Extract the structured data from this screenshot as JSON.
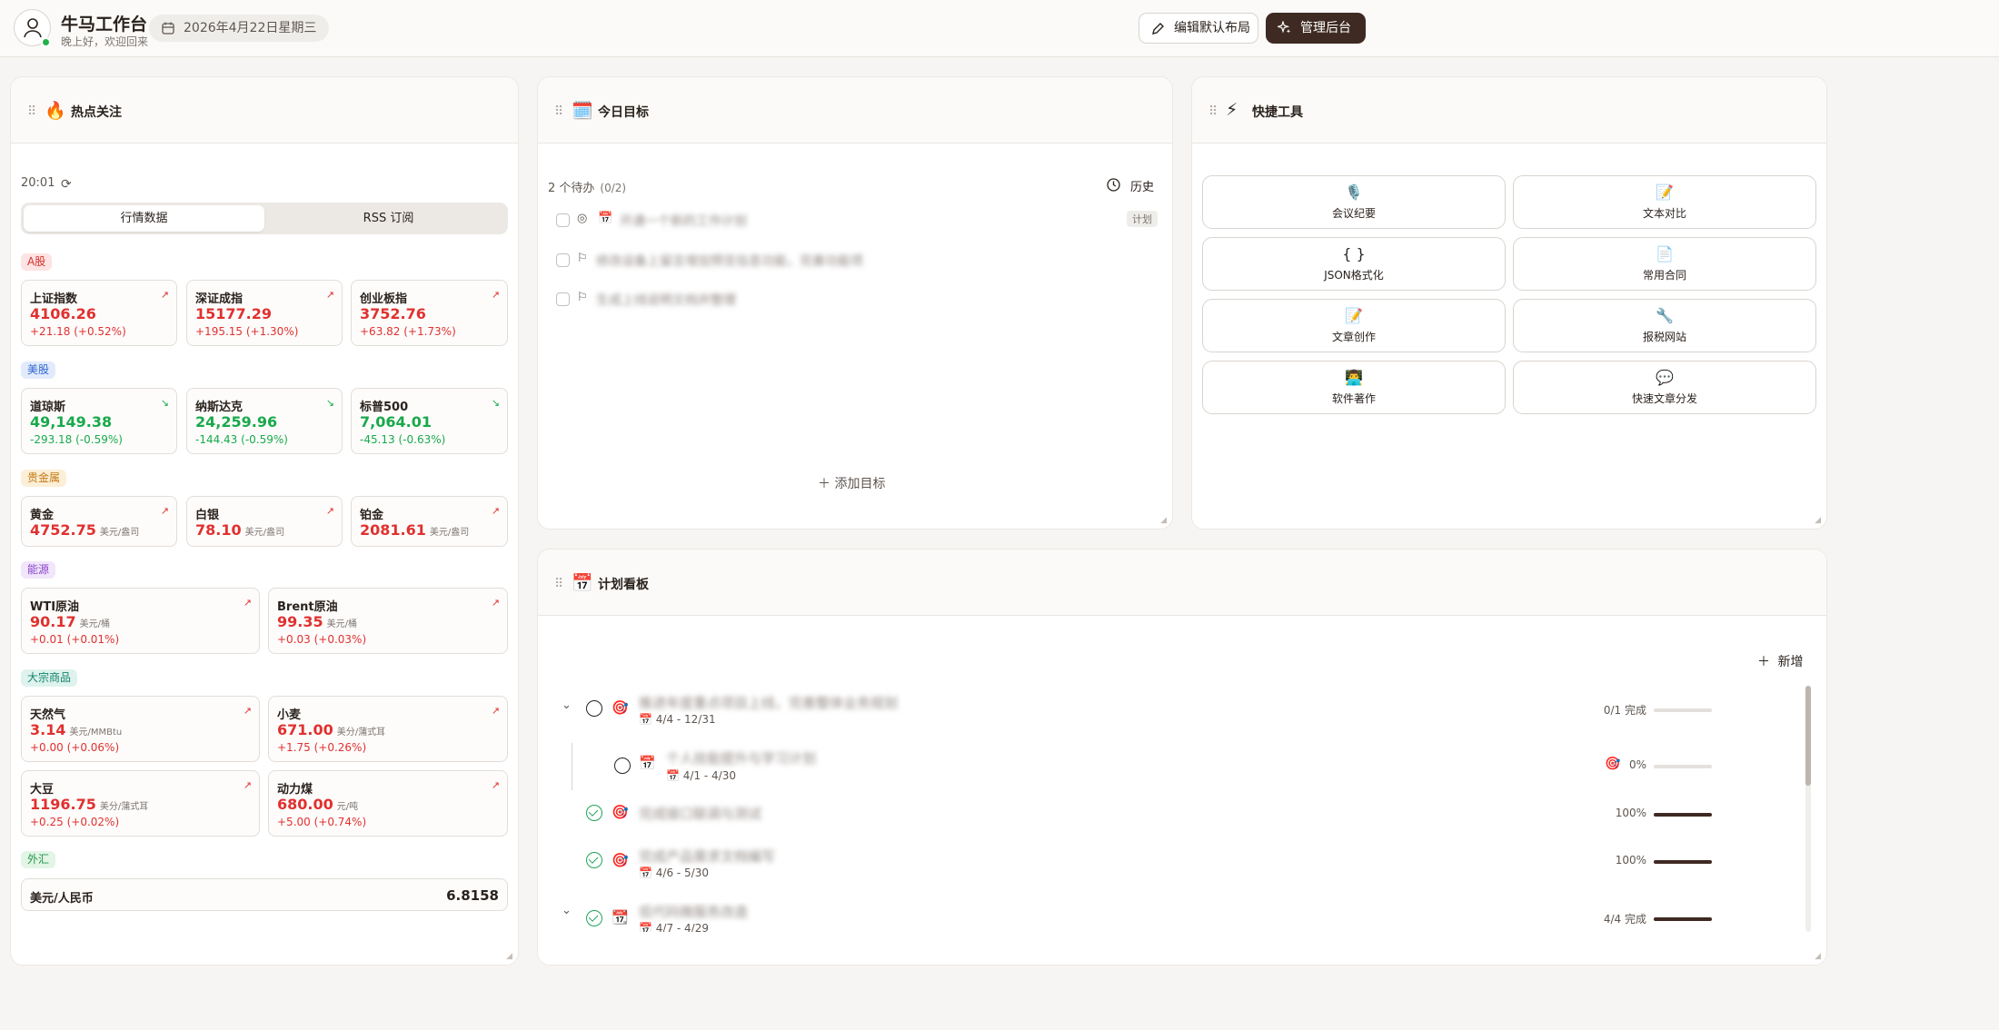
{
  "header": {
    "title": "牛马工作台",
    "greeting": "晚上好，欢迎回来",
    "date": "2026年4月22日星期三",
    "edit_layout": "编辑默认布局",
    "admin": "管理后台"
  },
  "hot": {
    "title": "热点关注",
    "time": "20:01",
    "tabs": [
      "行情数据",
      "RSS 订阅"
    ],
    "sections": {
      "a": "A股",
      "us": "美股",
      "metal": "贵金属",
      "energy": "能源",
      "commodity": "大宗商品",
      "fx": "外汇"
    },
    "tiles": [
      {
        "name": "上证指数",
        "value": "4106.26",
        "unit": "",
        "change": "+21.18 (+0.52%)",
        "trend": "up"
      },
      {
        "name": "深证成指",
        "value": "15177.29",
        "unit": "",
        "change": "+195.15 (+1.30%)",
        "trend": "up"
      },
      {
        "name": "创业板指",
        "value": "3752.76",
        "unit": "",
        "change": "+63.82 (+1.73%)",
        "trend": "up"
      },
      {
        "name": "道琼斯",
        "value": "49,149.38",
        "unit": "",
        "change": "-293.18 (-0.59%)",
        "trend": "down"
      },
      {
        "name": "纳斯达克",
        "value": "24,259.96",
        "unit": "",
        "change": "-144.43 (-0.59%)",
        "trend": "down"
      },
      {
        "name": "标普500",
        "value": "7,064.01",
        "unit": "",
        "change": "-45.13 (-0.63%)",
        "trend": "down"
      },
      {
        "name": "黄金",
        "value": "4752.75",
        "unit": "美元/盎司",
        "change": "",
        "trend": "up"
      },
      {
        "name": "白银",
        "value": "78.10",
        "unit": "美元/盎司",
        "change": "",
        "trend": "up"
      },
      {
        "name": "铂金",
        "value": "2081.61",
        "unit": "美元/盎司",
        "change": "",
        "trend": "up"
      },
      {
        "name": "WTI原油",
        "value": "90.17",
        "unit": "美元/桶",
        "change": "+0.01 (+0.01%)",
        "trend": "up"
      },
      {
        "name": "Brent原油",
        "value": "99.35",
        "unit": "美元/桶",
        "change": "+0.03 (+0.03%)",
        "trend": "up"
      },
      {
        "name": "天然气",
        "value": "3.14",
        "unit": "美元/MMBtu",
        "change": "+0.00 (+0.06%)",
        "trend": "up"
      },
      {
        "name": "小麦",
        "value": "671.00",
        "unit": "美分/蒲式耳",
        "change": "+1.75 (+0.26%)",
        "trend": "up"
      },
      {
        "name": "大豆",
        "value": "1196.75",
        "unit": "美分/蒲式耳",
        "change": "+0.25 (+0.02%)",
        "trend": "up"
      },
      {
        "name": "动力煤",
        "value": "680.00",
        "unit": "元/吨",
        "change": "+5.00 (+0.74%)",
        "trend": "up"
      }
    ],
    "fx": {
      "name": "美元/人民币",
      "value": "6.8158"
    }
  },
  "goals": {
    "title": "今日目标",
    "count": "2 个待办",
    "ratio": "(0/2)",
    "history": "历史",
    "items": [
      {
        "text": "开通一个新的工作计划",
        "tag": "计划"
      },
      {
        "text": "修改设备上留言增加预览信息功能，完善功能项"
      },
      {
        "text": "生成上线说明文档并整理"
      }
    ],
    "add": "添加目标"
  },
  "tools": {
    "title": "快捷工具",
    "items": [
      {
        "icon": "🎙️",
        "label": "会议纪要"
      },
      {
        "icon": "📝",
        "label": "文本对比"
      },
      {
        "icon": "{ }",
        "label": "JSON格式化"
      },
      {
        "icon": "📄",
        "label": "常用合同"
      },
      {
        "icon": "📝",
        "label": "文章创作"
      },
      {
        "icon": "🔧",
        "label": "报税网站"
      },
      {
        "icon": "👨‍💻",
        "label": "软件著作"
      },
      {
        "icon": "💬",
        "label": "快速文章分发"
      }
    ]
  },
  "plan": {
    "title": "计划看板",
    "new": "新增",
    "rows": [
      {
        "title": "推进年度重点项目上线，完善整体业务规划",
        "date": "4/4 - 12/31",
        "status": "0/1 完成",
        "progress": 0
      },
      {
        "title": "个人技能提升与学习计划",
        "date": "4/1 - 4/30",
        "status": "0%",
        "progress": 0
      },
      {
        "title": "完成接口联调与测试",
        "date": "",
        "status": "100%",
        "progress": 100
      },
      {
        "title": "完成产品需求文档编写",
        "date": "4/6 - 5/30",
        "status": "100%",
        "progress": 100
      },
      {
        "title": "低代码微服务改造",
        "date": "4/7 - 4/29",
        "status": "4/4 完成",
        "progress": 100
      }
    ]
  }
}
